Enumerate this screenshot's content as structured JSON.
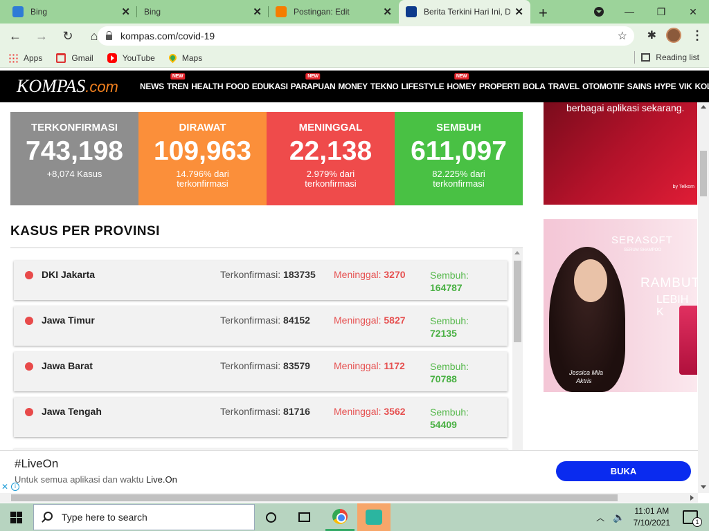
{
  "browser": {
    "tabs": [
      {
        "title": "Bing",
        "favicon": "bing-icon",
        "color": "#2e7bd6"
      },
      {
        "title": "Bing",
        "favicon": "bing-icon",
        "color": "#2e7bd6"
      },
      {
        "title": "Postingan: Edit",
        "favicon": "blogger-icon",
        "color": "#f57d00"
      },
      {
        "title": "Berita Terkini Hari Ini, Di",
        "favicon": "kompas-icon",
        "color": "#0d3b8c"
      }
    ],
    "active_tab": 3,
    "address": "kompas.com/covid-19",
    "bookmarks": [
      {
        "label": "Apps",
        "icon": "apps-icon"
      },
      {
        "label": "Gmail",
        "icon": "gmail-icon"
      },
      {
        "label": "YouTube",
        "icon": "youtube-icon"
      },
      {
        "label": "Maps",
        "icon": "maps-icon"
      }
    ],
    "reading_list": "Reading list"
  },
  "site": {
    "logo_main": "KOMPAS",
    "logo_domain": ".com",
    "nav": [
      {
        "label": "NEWS",
        "new": false
      },
      {
        "label": "TREN",
        "new": true
      },
      {
        "label": "HEALTH",
        "new": false
      },
      {
        "label": "FOOD",
        "new": false
      },
      {
        "label": "EDUKASI",
        "new": false
      },
      {
        "label": "PARAPUAN",
        "new": true
      },
      {
        "label": "MONEY",
        "new": false
      },
      {
        "label": "TEKNO",
        "new": false
      },
      {
        "label": "LIFESTYLE",
        "new": false
      },
      {
        "label": "HOMEY",
        "new": true
      },
      {
        "label": "PROPERTI",
        "new": false
      },
      {
        "label": "BOLA",
        "new": false
      },
      {
        "label": "TRAVEL",
        "new": false
      },
      {
        "label": "OTOMOTIF",
        "new": false
      },
      {
        "label": "SAINS",
        "new": false
      },
      {
        "label": "HYPE",
        "new": false
      },
      {
        "label": "VIK",
        "new": false
      },
      {
        "label": "KOLOM",
        "new": false
      }
    ],
    "new_badge": "NEW"
  },
  "stats": {
    "confirmed": {
      "label": "TERKONFIRMASI",
      "value": "743,198",
      "sub": "+8,074 Kasus",
      "color": "#8e8e8e"
    },
    "treated": {
      "label": "DIRAWAT",
      "value": "109,963",
      "sub1": "14.796% dari",
      "sub2": "terkonfirmasi",
      "color": "#fb8f3a"
    },
    "deaths": {
      "label": "MENINGGAL",
      "value": "22,138",
      "sub1": "2.979% dari",
      "sub2": "terkonfirmasi",
      "color": "#ef4b4b"
    },
    "recovered": {
      "label": "SEMBUH",
      "value": "611,097",
      "sub1": "82.225% dari",
      "sub2": "terkonfirmasi",
      "color": "#49c144"
    }
  },
  "provinces": {
    "title": "KASUS PER PROVINSI",
    "label_confirmed": "Terkonfirmasi: ",
    "label_deaths": "Meninggal: ",
    "label_recovered": "Sembuh:",
    "rows": [
      {
        "name": "DKI Jakarta",
        "confirmed": "183735",
        "deaths": "3270",
        "recovered": "164787"
      },
      {
        "name": "Jawa Timur",
        "confirmed": "84152",
        "deaths": "5827",
        "recovered": "72135"
      },
      {
        "name": "Jawa Barat",
        "confirmed": "83579",
        "deaths": "1172",
        "recovered": "70788"
      },
      {
        "name": "Jawa Tengah",
        "confirmed": "81716",
        "deaths": "3562",
        "recovered": "54409"
      }
    ]
  },
  "ads": {
    "telkom_text": "berbagai aplikasi sekarang.",
    "telkom_small": "by Telkom",
    "serasoft_brand": "SERASOFT",
    "serasoft_sub": "SERUM SHAMPOO",
    "serasoft_line1": "RAMBUT",
    "serasoft_line2": "LEBIH K",
    "serasoft_sig1": "Jessica Mila",
    "serasoft_sig2": "Aktris"
  },
  "banner": {
    "title": "#LiveOn",
    "sub_prefix": "Untuk semua aplikasi dan waktu ",
    "sub_brand": "Live.On",
    "button": "BUKA"
  },
  "taskbar": {
    "search_placeholder": "Type here to search",
    "time": "11:01 AM",
    "date": "7/10/2021",
    "notifications": "1"
  }
}
